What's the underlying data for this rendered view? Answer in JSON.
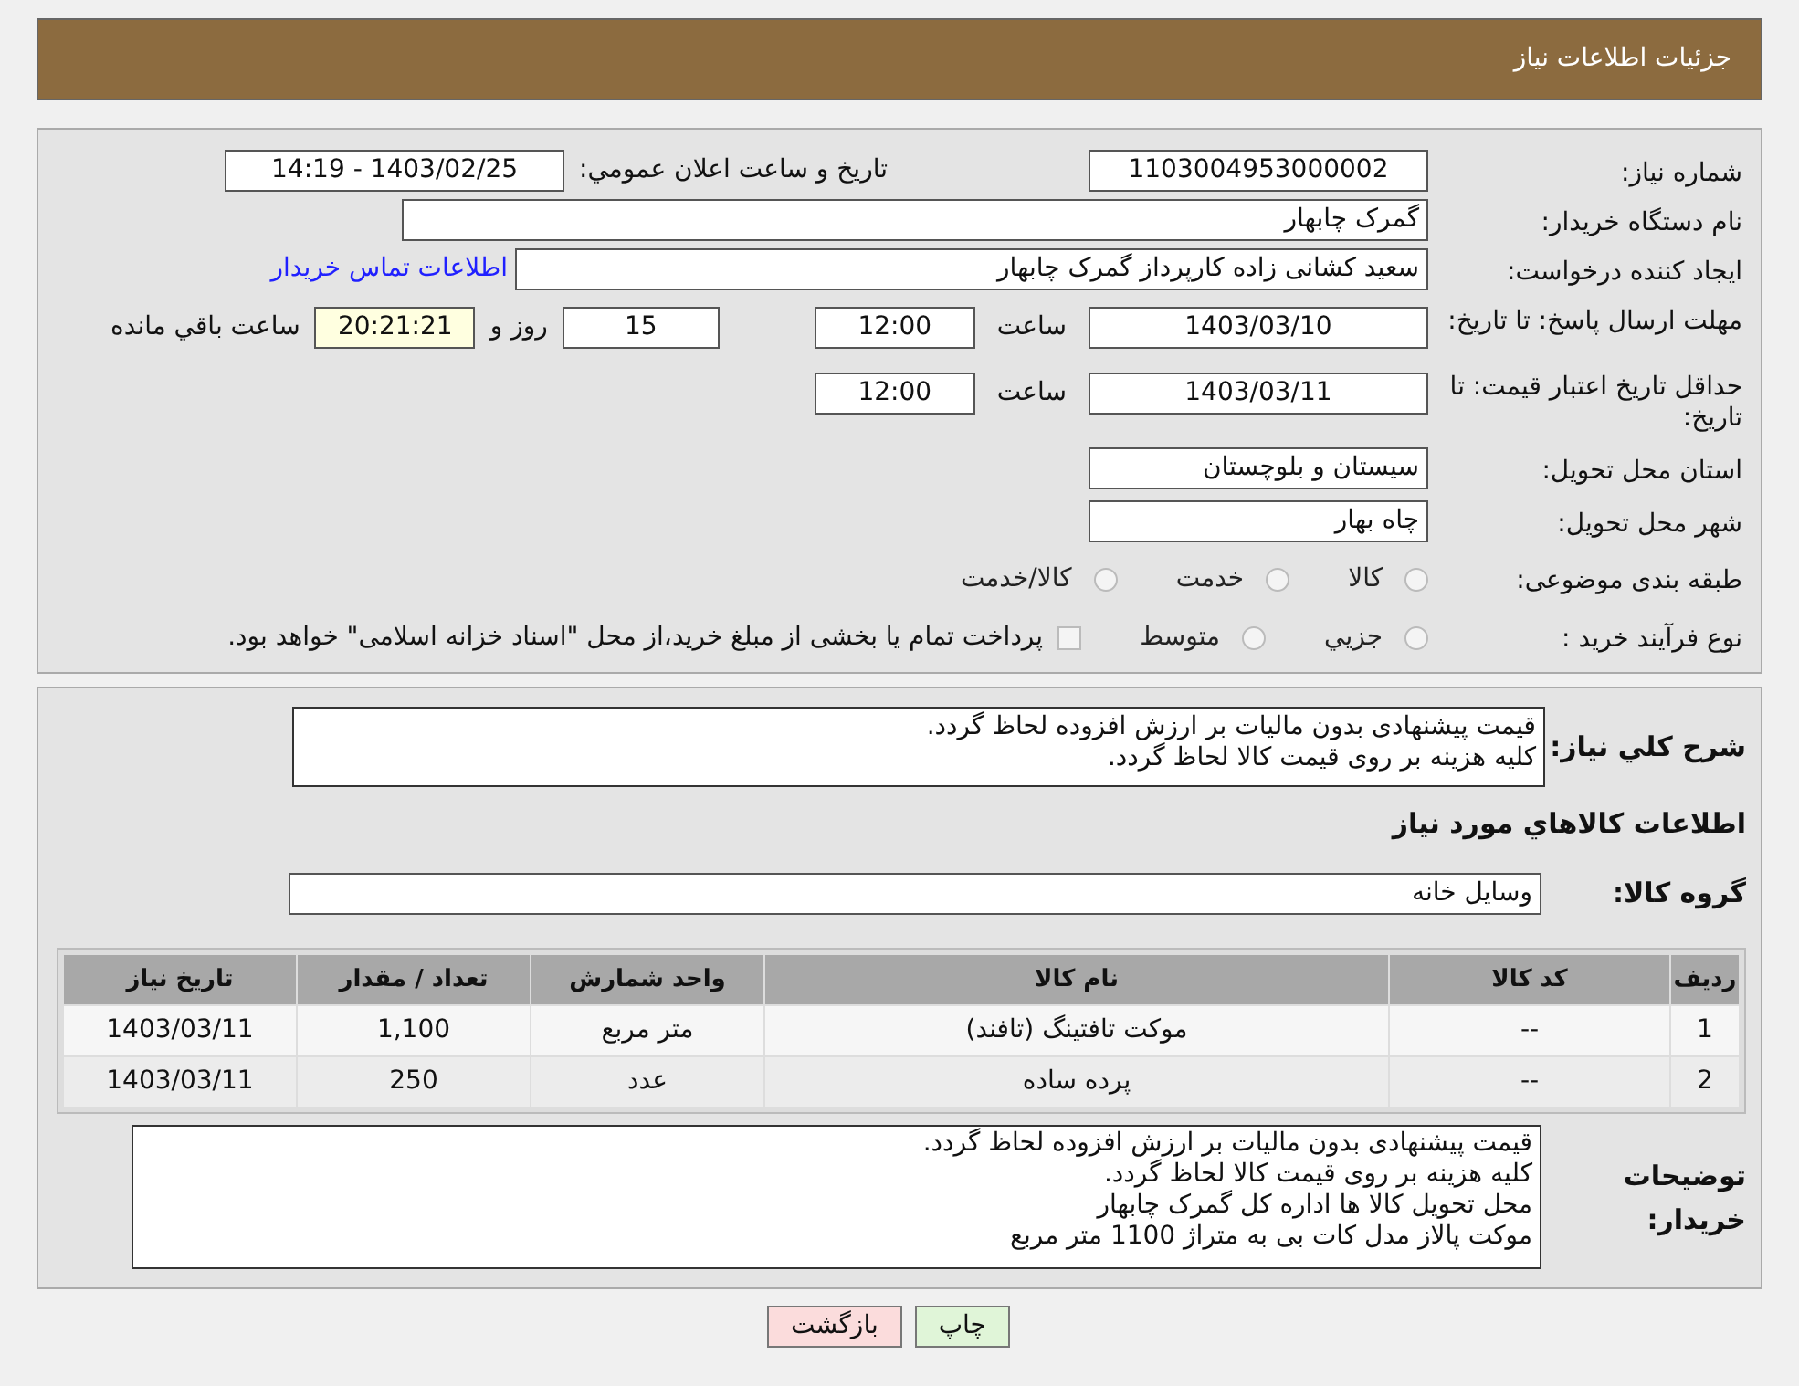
{
  "header": {
    "title": "جزئیات اطلاعات نیاز"
  },
  "need_number": {
    "label": "شماره نیاز:",
    "value": "1103004953000002"
  },
  "announce": {
    "label": "تاریخ و ساعت اعلان عمومي:",
    "value": "1403/02/25 - 14:19"
  },
  "buyer": {
    "label": "نام دستگاه خریدار:",
    "value": "گمرک چابهار"
  },
  "requester": {
    "label": "ایجاد کننده درخواست:",
    "value": "سعید کشانی زاده کارپرداز گمرک چابهار",
    "link": "اطلاعات تماس خریدار"
  },
  "reply_deadline": {
    "label": "مهلت ارسال پاسخ: تا تاریخ:",
    "date": "1403/03/10",
    "time_label": "ساعت",
    "time": "12:00",
    "days": "15",
    "days_label": "روز و",
    "remaining": "20:21:21",
    "remaining_label": "ساعت باقي مانده"
  },
  "price_validity": {
    "label": "حداقل تاریخ اعتبار قیمت: تا تاریخ:",
    "date": "1403/03/11",
    "time_label": "ساعت",
    "time": "12:00"
  },
  "province": {
    "label": "استان محل تحویل:",
    "value": "سیستان و بلوچستان"
  },
  "city": {
    "label": "شهر محل تحویل:",
    "value": "چاه بهار"
  },
  "category": {
    "label": "طبقه بندی موضوعی:",
    "options": [
      {
        "label": "کالا",
        "selected": false
      },
      {
        "label": "خدمت",
        "selected": false
      },
      {
        "label": "کالا/خدمت",
        "selected": false
      }
    ]
  },
  "purchase_type": {
    "label": "نوع فرآیند خرید :",
    "options": [
      {
        "label": "جزیي",
        "selected": false
      },
      {
        "label": "متوسط",
        "selected": false
      }
    ],
    "note": {
      "checked": false,
      "text": "پرداخت تمام یا بخشی از مبلغ خرید،از محل \"اسناد خزانه اسلامی\" خواهد بود."
    }
  },
  "description": {
    "label": "شرح کلي نياز:",
    "lines": [
      "قیمت پیشنهادی بدون مالیات بر ارزش افزوده لحاظ گردد.",
      "کلیه هزینه بر روی قیمت کالا لحاظ گردد."
    ]
  },
  "goods_title": "اطلاعات کالاهاي مورد نياز",
  "goods_group": {
    "label": "گروه کالا:",
    "value": "وسایل خانه"
  },
  "table": {
    "columns": [
      "رديف",
      "کد کالا",
      "نام کالا",
      "واحد شمارش",
      "تعداد / مقدار",
      "تاریخ نیاز"
    ],
    "rows": [
      [
        "1",
        "--",
        "موکت تافتینگ (تافند)",
        "متر مربع",
        "1,100",
        "1403/03/11"
      ],
      [
        "2",
        "--",
        "پرده ساده",
        "عدد",
        "250",
        "1403/03/11"
      ]
    ]
  },
  "buyer_notes": {
    "label": "توضیحات خریدار:",
    "lines": [
      "قیمت پیشنهادی بدون مالیات بر ارزش افزوده لحاظ گردد.",
      "کلیه هزینه بر روی قیمت کالا لحاظ گردد.",
      "محل تحویل کالا ها اداره کل گمرک چابهار",
      "موکت پالاز مدل کات بی به متراژ 1100 متر مربع"
    ]
  },
  "buttons": [
    {
      "label": "چاپ",
      "kind": "print"
    },
    {
      "label": "بازگشت",
      "kind": "back"
    }
  ]
}
